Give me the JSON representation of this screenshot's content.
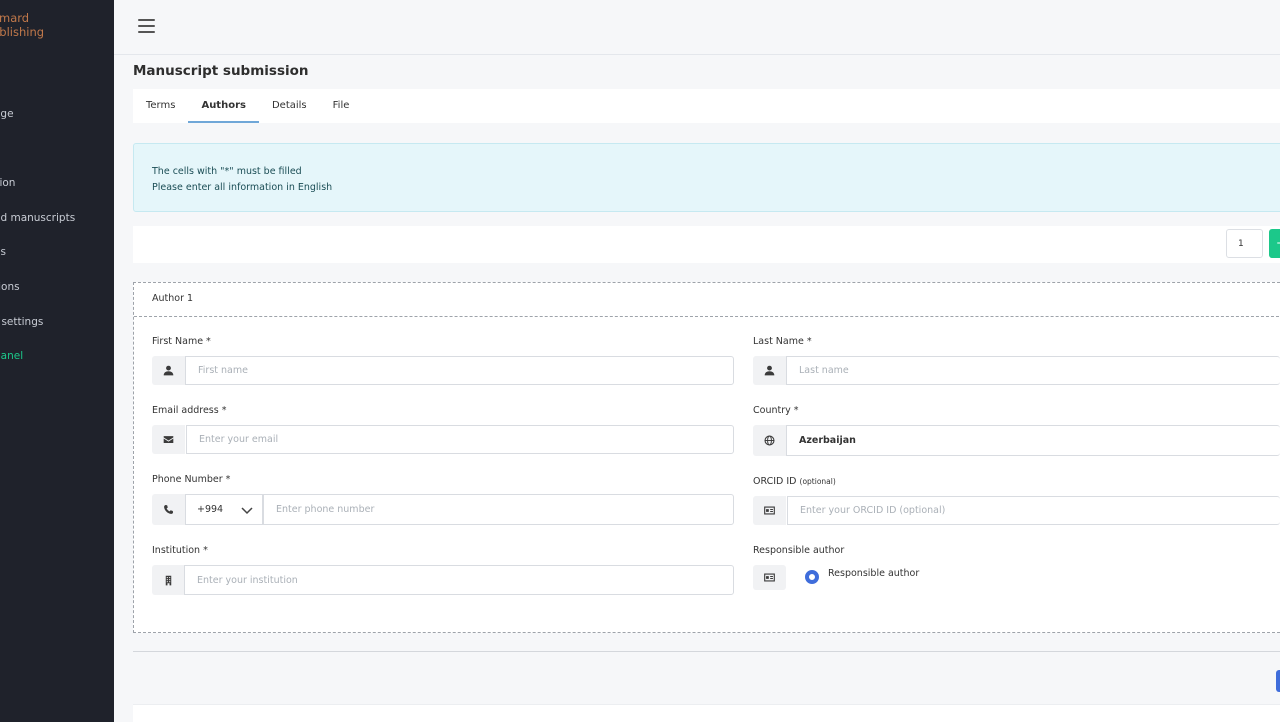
{
  "brand": {
    "line1": "omard",
    "line2": "ublishing"
  },
  "sidebar": {
    "items": [
      {
        "label": "age"
      },
      {
        "label": "sion"
      },
      {
        "label": "ed manuscripts"
      },
      {
        "label": "es"
      },
      {
        "label": "tions"
      },
      {
        "label": "t settings"
      },
      {
        "label": "panel"
      }
    ]
  },
  "page": {
    "title": "Manuscript submission"
  },
  "tabs": [
    {
      "label": "Terms"
    },
    {
      "label": "Authors"
    },
    {
      "label": "Details"
    },
    {
      "label": "File"
    }
  ],
  "alert": {
    "line1": "The cells with \"*\" must be filled",
    "line2": "Please enter all information in English"
  },
  "pagination": {
    "current": "1",
    "add_label": "+"
  },
  "author": {
    "title": "Author 1",
    "first_name": {
      "label": "First Name *",
      "placeholder": "First name"
    },
    "last_name": {
      "label": "Last Name *",
      "placeholder": "Last name"
    },
    "email": {
      "label": "Email address *",
      "placeholder": "Enter your email"
    },
    "country": {
      "label": "Country *",
      "value": "Azerbaijan"
    },
    "phone": {
      "label": "Phone Number *",
      "code": "+994",
      "placeholder": "Enter phone number"
    },
    "orcid": {
      "label": "ORCID ID",
      "optional": "(optional)",
      "placeholder": "Enter your ORCID ID (optional)"
    },
    "institution": {
      "label": "Institution *",
      "placeholder": "Enter your institution"
    },
    "responsible": {
      "label": "Responsible author",
      "option_label": "Responsible author"
    }
  },
  "colors": {
    "sidebar_bg": "#1f222b",
    "brand": "#c0784a",
    "accent_green": "#1cc88a",
    "accent_blue": "#3f6ddb",
    "alert_bg": "#e5f6fa"
  },
  "icons": [
    "menu-icon",
    "user-icon",
    "envelope-icon",
    "phone-icon",
    "globe-icon",
    "id-card-icon",
    "building-icon",
    "chevron-down-icon"
  ]
}
